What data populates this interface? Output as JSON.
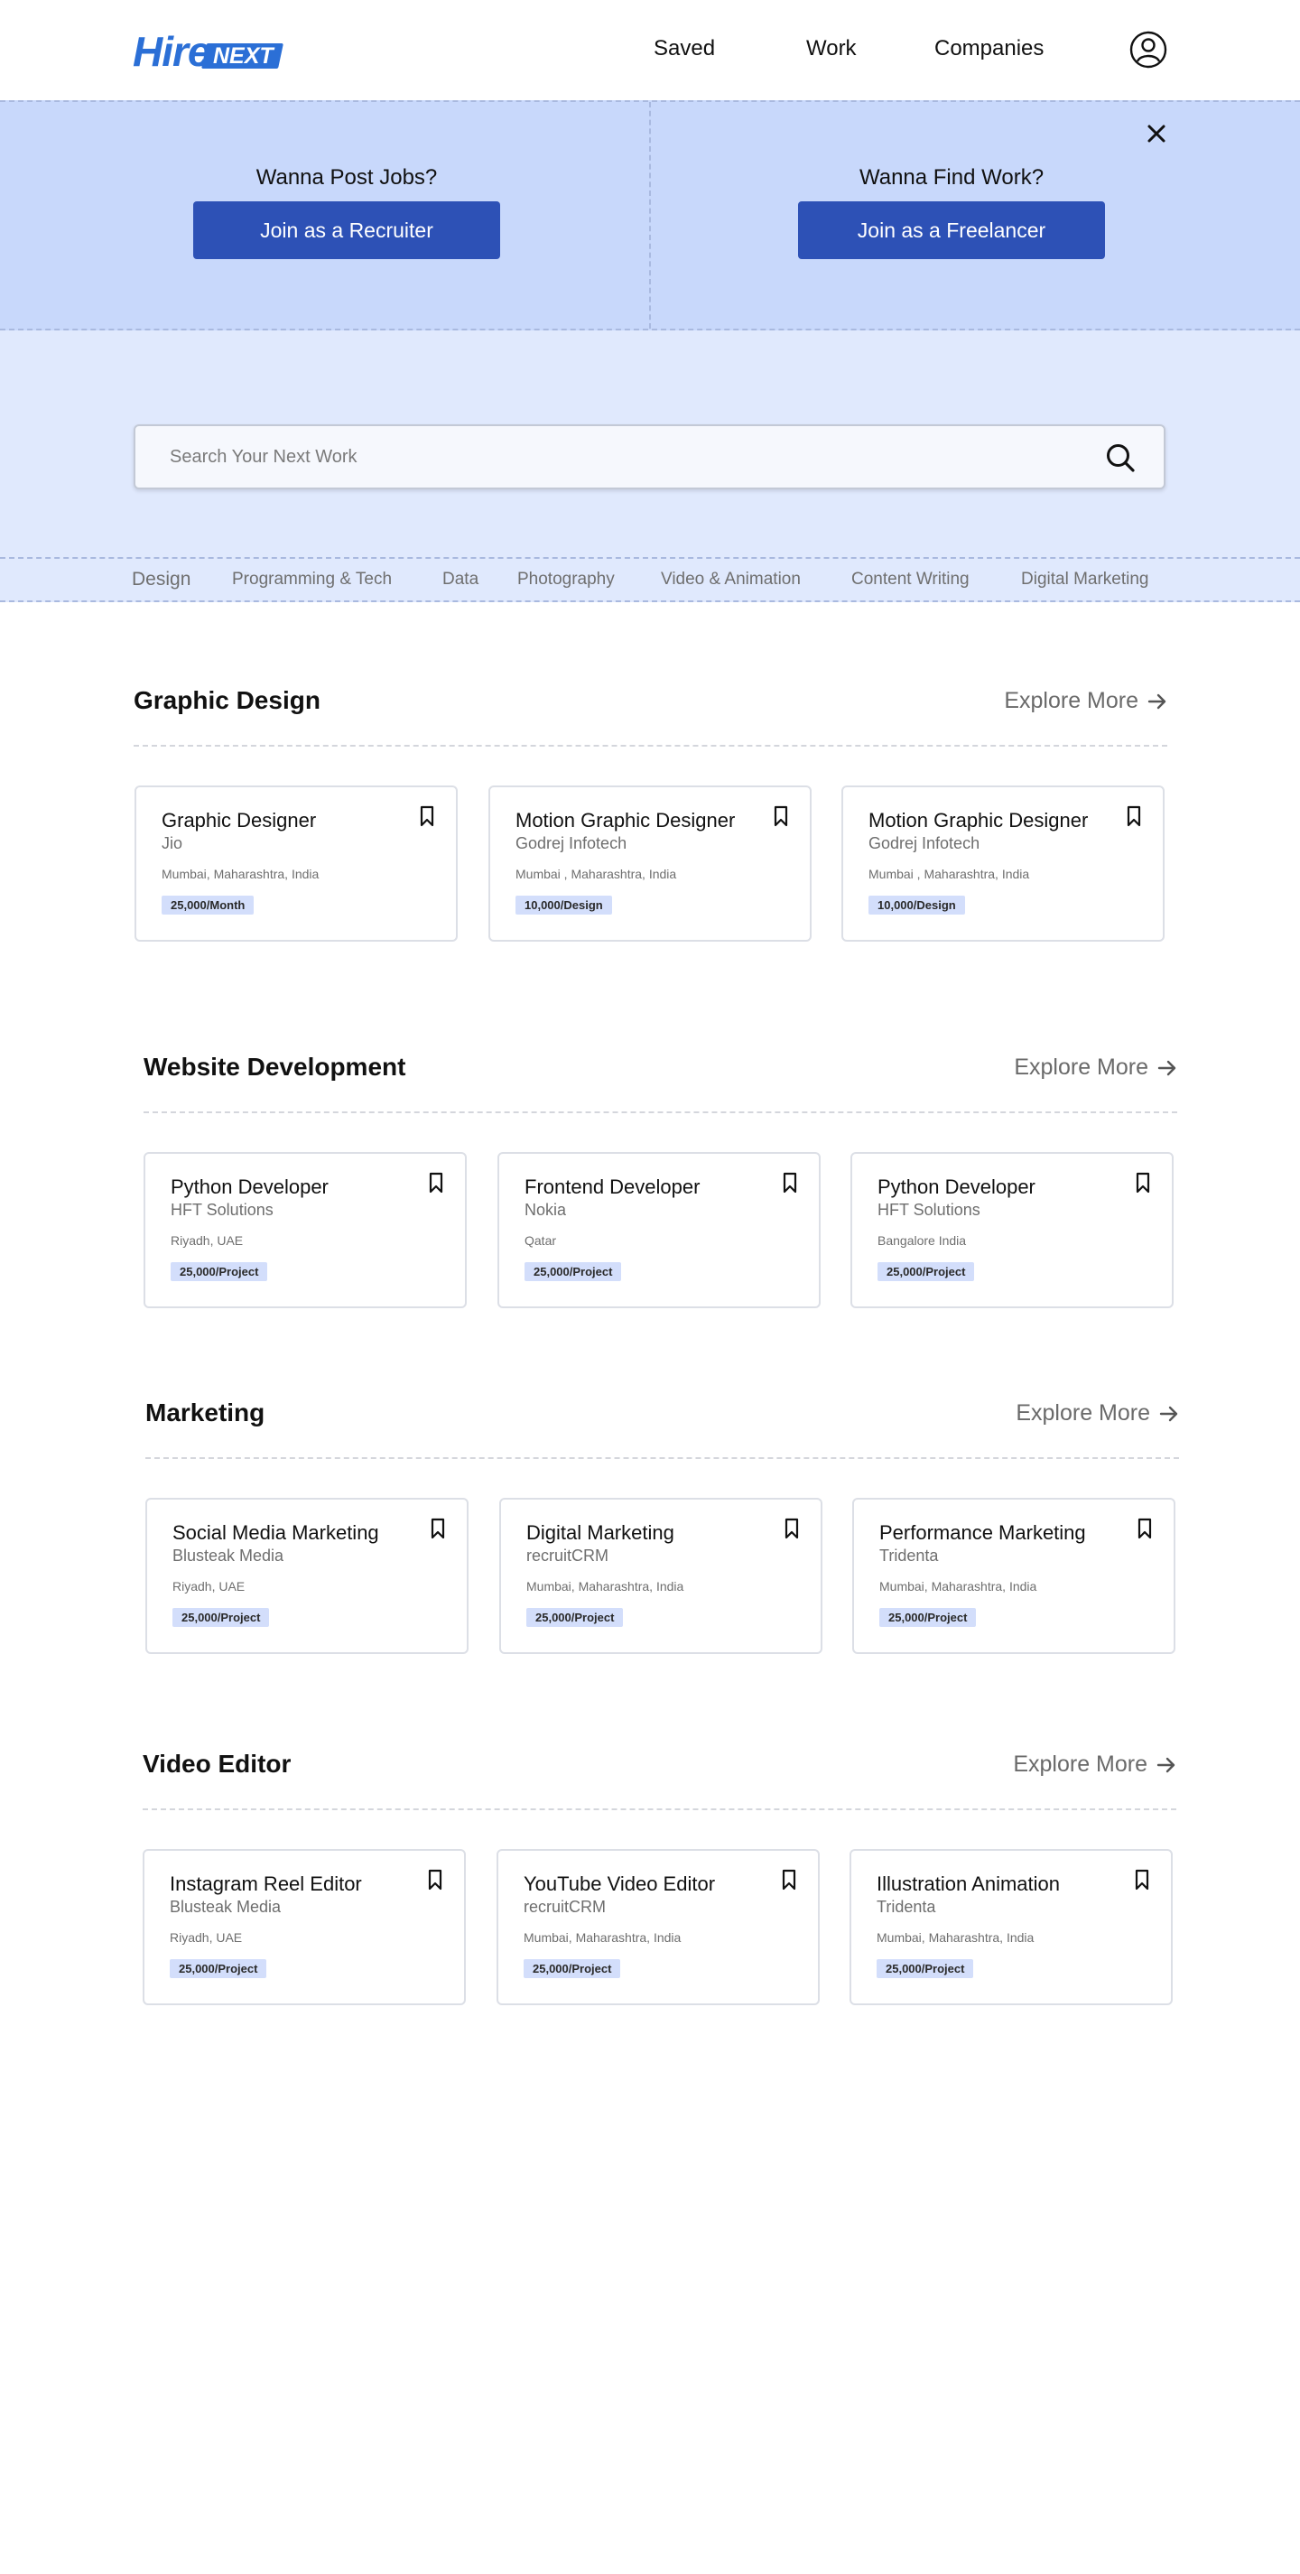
{
  "brand": {
    "logo_hire": "Hire",
    "logo_next": "NEXT",
    "primary_color": "#2b6fd6",
    "button_color": "#2d51b6"
  },
  "nav": {
    "saved": "Saved",
    "work": "Work",
    "companies": "Companies",
    "profile_icon": "user-circle-icon"
  },
  "banner": {
    "left": {
      "title": "Wanna Post Jobs?",
      "button": "Join as a Recruiter"
    },
    "right": {
      "title": "Wanna Find Work?",
      "button": "Join as a Freelancer"
    },
    "close_icon": "close-icon"
  },
  "search": {
    "placeholder": "Search Your Next Work",
    "icon": "search-icon"
  },
  "categories": [
    "Design",
    "Programming & Tech",
    "Data",
    "Photography",
    "Video & Animation",
    "Content Writing",
    "Digital Marketing"
  ],
  "explore_label": "Explore More",
  "sections": [
    {
      "title": "Graphic Design",
      "cards": [
        {
          "title": "Graphic Designer",
          "company": "Jio",
          "location": "Mumbai, Maharashtra, India",
          "pay": "25,000/Month"
        },
        {
          "title": "Motion Graphic Designer",
          "company": "Godrej Infotech",
          "location": "Mumbai , Maharashtra, India",
          "pay": "10,000/Design"
        },
        {
          "title": "Motion Graphic Designer",
          "company": "Godrej Infotech",
          "location": "Mumbai , Maharashtra, India",
          "pay": "10,000/Design"
        }
      ]
    },
    {
      "title": "Website Development",
      "cards": [
        {
          "title": "Python Developer",
          "company": "HFT Solutions",
          "location": "Riyadh, UAE",
          "pay": "25,000/Project"
        },
        {
          "title": "Frontend Developer",
          "company": "Nokia",
          "location": "Qatar",
          "pay": "25,000/Project"
        },
        {
          "title": "Python Developer",
          "company": "HFT Solutions",
          "location": "Bangalore India",
          "pay": "25,000/Project"
        }
      ]
    },
    {
      "title": "Marketing",
      "cards": [
        {
          "title": "Social Media Marketing",
          "company": "Blusteak Media",
          "location": "Riyadh, UAE",
          "pay": "25,000/Project"
        },
        {
          "title": "Digital Marketing",
          "company": "recruitCRM",
          "location": "Mumbai, Maharashtra, India",
          "pay": "25,000/Project"
        },
        {
          "title": "Performance Marketing",
          "company": "Tridenta",
          "location": "Mumbai, Maharashtra, India",
          "pay": "25,000/Project"
        }
      ]
    },
    {
      "title": "Video Editor",
      "cards": [
        {
          "title": "Instagram Reel Editor",
          "company": "Blusteak Media",
          "location": "Riyadh, UAE",
          "pay": "25,000/Project"
        },
        {
          "title": "YouTube Video Editor",
          "company": "recruitCRM",
          "location": "Mumbai, Maharashtra, India",
          "pay": "25,000/Project"
        },
        {
          "title": "Illustration Animation",
          "company": "Tridenta",
          "location": "Mumbai, Maharashtra, India",
          "pay": "25,000/Project"
        }
      ]
    }
  ]
}
